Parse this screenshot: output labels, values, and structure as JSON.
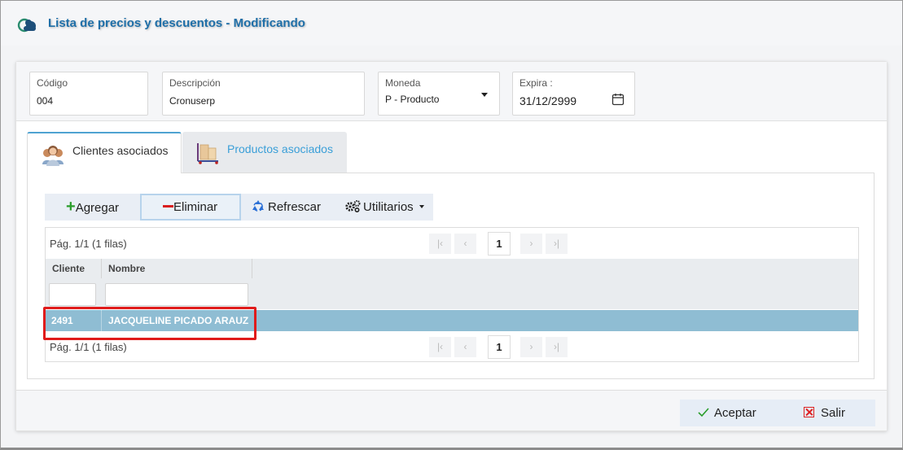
{
  "window": {
    "title": "Lista de precios y descuentos - Modificando"
  },
  "fields": {
    "codigo": {
      "label": "Código",
      "value": "004"
    },
    "descripcion": {
      "label": "Descripción",
      "value": "Cronuserp"
    },
    "moneda": {
      "label": "Moneda",
      "value": "P - Producto"
    },
    "expira": {
      "label": "Expira :",
      "value": "31/12/2999"
    }
  },
  "tabs": [
    {
      "label": "Clientes asociados",
      "active": true,
      "icon": "users-icon"
    },
    {
      "label": "Productos asociados",
      "active": false,
      "icon": "boxes-cart-icon"
    }
  ],
  "toolbar": {
    "add_label": "Agregar",
    "delete_label": "Eliminar",
    "refresh_label": "Refrescar",
    "utilities_label": "Utilitarios"
  },
  "pager": {
    "info": "Pág. 1/1 (1 filas)",
    "current_page": "1"
  },
  "table": {
    "columns": [
      "Cliente",
      "Nombre"
    ],
    "rows": [
      {
        "cliente": "2491",
        "nombre": "JACQUELINE PICADO ARAUZ",
        "selected": true
      }
    ]
  },
  "footer": {
    "accept_label": "Aceptar",
    "exit_label": "Salir"
  },
  "colors": {
    "title": "#1f6fa8",
    "selected_row": "#8fbdd3",
    "highlight_border": "#e01b1b",
    "add_icon": "#2a9d2a",
    "delete_icon": "#d91e1e",
    "tab_inactive_text": "#3a9fd8"
  }
}
